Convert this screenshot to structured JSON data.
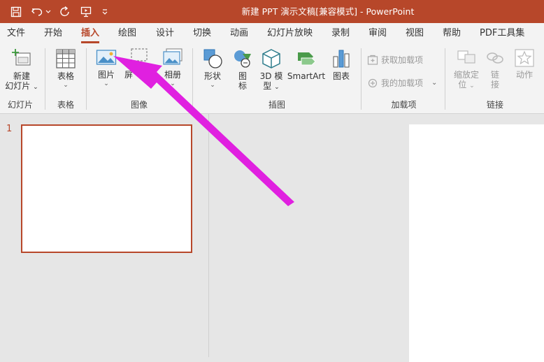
{
  "window": {
    "doc_title": "新建 PPT 演示文稿[兼容模式]  -  PowerPoint",
    "accent_color": "#b7472a",
    "qat_icons": [
      "save-icon",
      "undo-icon",
      "redo-icon",
      "present-icon",
      "customize-icon"
    ]
  },
  "tabs": [
    {
      "label": "文件"
    },
    {
      "label": "开始"
    },
    {
      "label": "插入",
      "active": true
    },
    {
      "label": "绘图"
    },
    {
      "label": "设计"
    },
    {
      "label": "切换"
    },
    {
      "label": "动画"
    },
    {
      "label": "幻灯片放映"
    },
    {
      "label": "录制"
    },
    {
      "label": "审阅"
    },
    {
      "label": "视图"
    },
    {
      "label": "帮助"
    },
    {
      "label": "PDF工具集"
    }
  ],
  "ribbon": {
    "new_slide": {
      "line1": "新建",
      "line2": "幻灯片"
    },
    "table": {
      "label": "表格"
    },
    "picture": {
      "label": "图片"
    },
    "screenshot_partial": "屏",
    "screenshot_partial2": "图",
    "album": {
      "label": "相册"
    },
    "shapes": {
      "label": "形状"
    },
    "icons": {
      "line1": "图",
      "line2": "标"
    },
    "model3d": {
      "line1": "3D 模",
      "line2": "型"
    },
    "smartart": {
      "label": "SmartArt"
    },
    "chart": {
      "label": "图表"
    },
    "get_addins": {
      "label": "获取加载项"
    },
    "my_addins": {
      "label": "我的加载项"
    },
    "zoom": {
      "line1": "缩放定",
      "line2": "位"
    },
    "link": {
      "line1": "链",
      "line2": "接"
    },
    "action": {
      "label": "动作"
    },
    "groups": {
      "slides": "幻灯片",
      "tables": "表格",
      "images": "图像",
      "illustrations": "插图",
      "addins": "加载项",
      "links": "链接"
    }
  },
  "slides_pane": {
    "slide_number": "1"
  },
  "annotation": {
    "arrow_color": "#e020e0"
  }
}
